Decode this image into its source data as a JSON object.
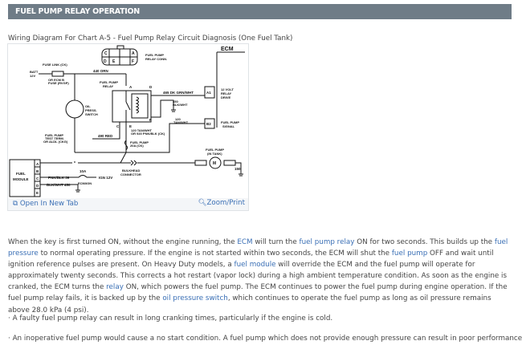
{
  "section": {
    "title": "FUEL PUMP RELAY OPERATION"
  },
  "figure": {
    "caption": "Wiring Diagram For Chart A-5 - Fuel Pump Relay Circuit Diagnosis (One Fuel Tank)",
    "open_label": "Open In New Tab",
    "zoom_label": "Zoom/Print",
    "open_icon": "new-tab-icon",
    "zoom_icon": "magnifier-icon",
    "diagram_labels": {
      "conn_pins": [
        "C",
        "A",
        "D",
        "E",
        "F"
      ],
      "relay_conn": [
        "FUEL PUMP",
        "RELAY CONN."
      ],
      "ecm": "ECM",
      "fuse_link": "FUSE LINK (CK)",
      "batt": [
        "BATT",
        "12V"
      ],
      "fuse_alt": [
        "OR ECM B",
        "FUSE (RVGP)"
      ],
      "wire_440": "440 ORN",
      "relay": [
        "FUEL PUMP",
        "RELAY"
      ],
      "pin_a": "A",
      "pin_d": "D",
      "pin_f": "F",
      "pin_c": "C",
      "pin_b": "B",
      "pin_e": "E",
      "wire_465": "465 DK GRN/WHT",
      "a1": "A1",
      "relay_drive": [
        "12 VOLT",
        "RELAY",
        "DRIVE"
      ],
      "wire_450": [
        "450",
        "BLK/WHT"
      ],
      "oil_switch": [
        "OIL",
        "PRESS.",
        "SWITCH"
      ],
      "wire_120": [
        "120",
        "TAN/WHT"
      ],
      "b2": "B2",
      "pump_signal": [
        "FUEL PUMP",
        "SIGNAL"
      ],
      "wire_120_alt": [
        "120 TAN/WHT",
        "OR 920 PNK/BLK (CK)"
      ],
      "test_term": [
        "FUEL PUMP",
        "TEST TERM.",
        "OR ALDL (CKG)"
      ],
      "wire_490": "490 RED",
      "fuse_20a": [
        "FUEL PUMP",
        "20A (CK)"
      ],
      "pump_tank": [
        "FUEL PUMP",
        "(IN TANK)"
      ],
      "motor": "M",
      "bulkhead": [
        "BULKHEAD",
        "CONNECTOR"
      ],
      "wire_150": "150",
      "module": [
        "FUEL",
        "MODULE"
      ],
      "module_pins": [
        "A",
        "B",
        "C",
        "D",
        "E"
      ],
      "wire_39": "PNK/BLK 39",
      "fuse_10a": "10A",
      "ign": "IGN 12V",
      "ecm_ign": "ECM/IGN",
      "wire_450b": "BLK/WHT 450",
      "star": "*"
    }
  },
  "paragraph": [
    {
      "t": "When the key is first turned ON, without the engine running, the "
    },
    {
      "t": "ECM",
      "link": true
    },
    {
      "t": " will turn the "
    },
    {
      "t": "fuel pump relay",
      "link": true
    },
    {
      "t": " ON for two seconds. This builds up the "
    },
    {
      "t": "fuel pressure",
      "link": true
    },
    {
      "t": " to normal operating pressure. If the engine is not started within two seconds, the ECM will shut the "
    },
    {
      "t": "fuel pump",
      "link": true
    },
    {
      "t": " OFF and wait until ignition reference pulses are present. On Heavy Duty models, a "
    },
    {
      "t": "fuel module",
      "link": true
    },
    {
      "t": " will override the ECM and the fuel pump will operate for approximately twenty seconds. This corrects a hot restart (vapor lock) during a high ambient temperature condition. As soon as the engine is cranked, the ECM turns the "
    },
    {
      "t": "relay",
      "link": true
    },
    {
      "t": " ON, which powers the fuel pump. The ECM continues to power the fuel pump during engine operation. If the fuel pump relay fails, it is backed up by the "
    },
    {
      "t": "oil pressure switch",
      "link": true
    },
    {
      "t": ", which continues to operate the fuel pump as long as oil pressure remains above 28.0 kPa (4 psi)."
    }
  ],
  "bullets": [
    "·  A faulty fuel pump relay can result in long cranking times, particularly if the engine is cold.",
    "·  An inoperative fuel pump would cause a no start condition. A fuel pump which does not provide enough pressure can result in poor performance."
  ]
}
